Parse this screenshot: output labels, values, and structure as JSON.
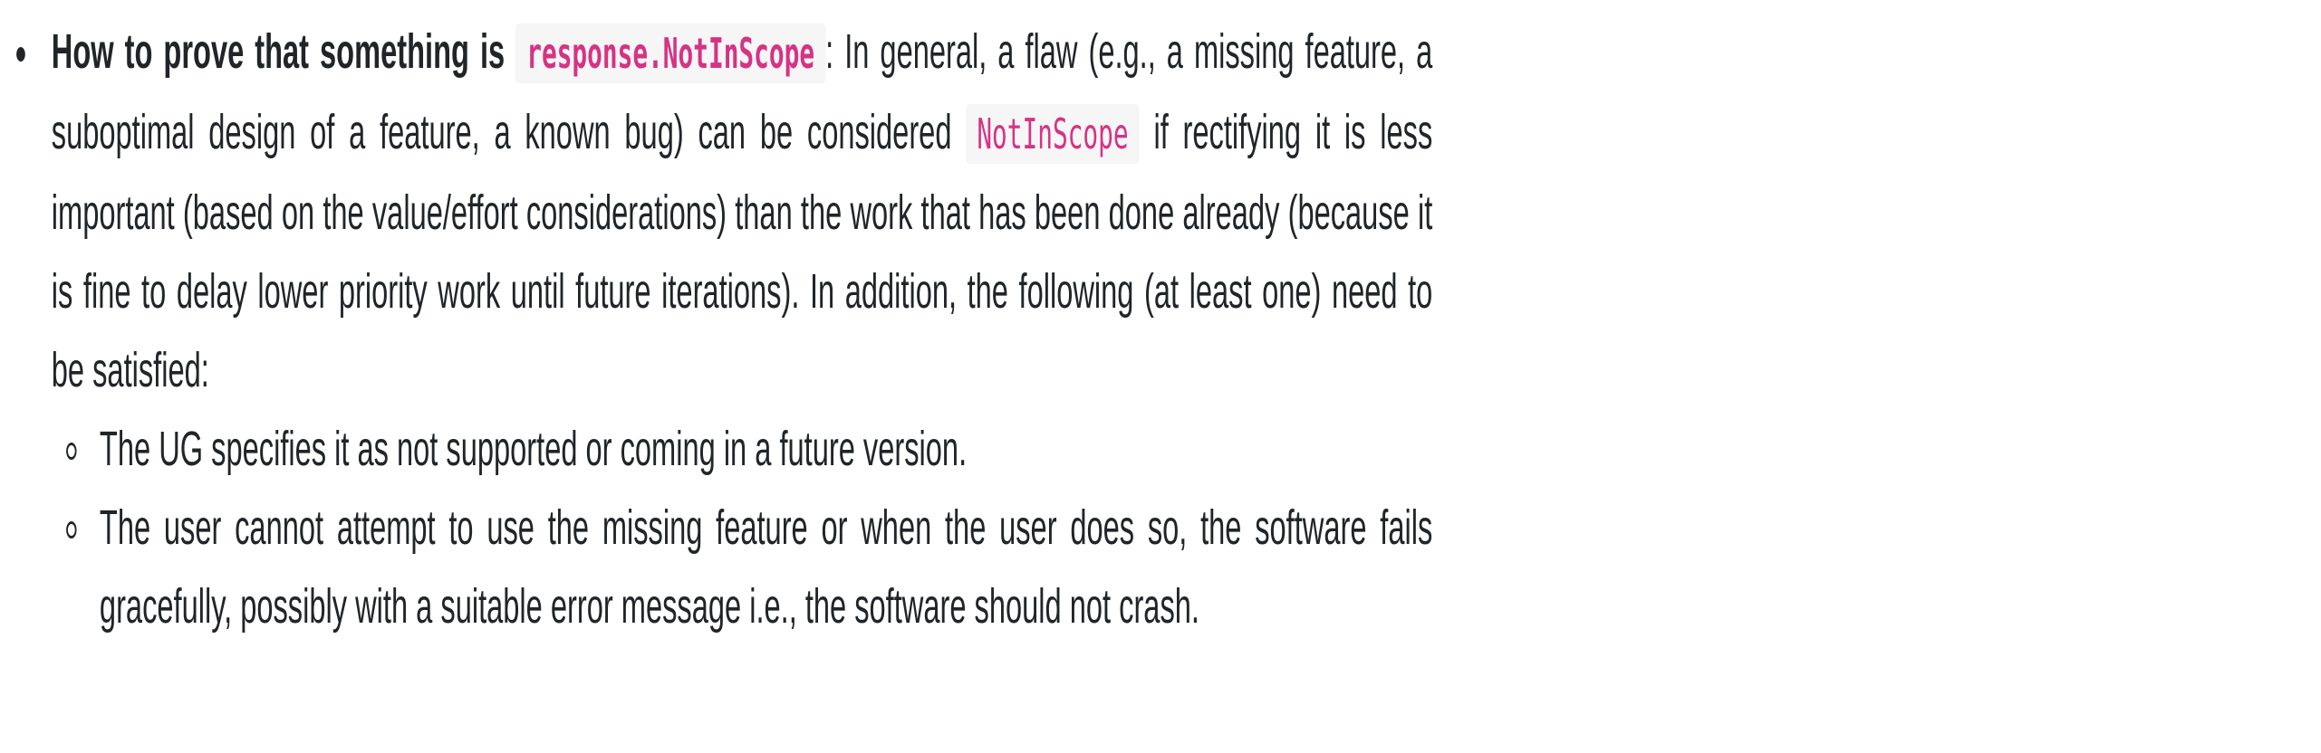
{
  "item": {
    "lead_text": "How to prove that something is",
    "lead_code": "response.NotInScope",
    "body_1": ": In general, a flaw (e.g., a missing feature, a suboptimal design of a feature, a known bug) can be considered",
    "inline_code": "NotInScope",
    "body_2": "if rectifying it is less important (based on the value/effort considerations) than the work that has been done already (because it is fine to delay lower priority work until future iterations). In addition, the following (at least one) need to be satisfied:",
    "subitems": [
      {
        "text": "The UG specifies it as not supported or coming in a future version."
      },
      {
        "text": "The user cannot attempt to use the missing feature or when the user does so, the software fails gracefully, possibly with a suitable error message i.e., the software should not crash."
      }
    ]
  },
  "colors": {
    "text": "#212529",
    "code_text": "#d63384",
    "code_background": "#f6f6f7"
  },
  "icons": {
    "outer_bullet": "filled-disc-bullet-icon",
    "inner_bullet": "hollow-circle-bullet-icon"
  }
}
